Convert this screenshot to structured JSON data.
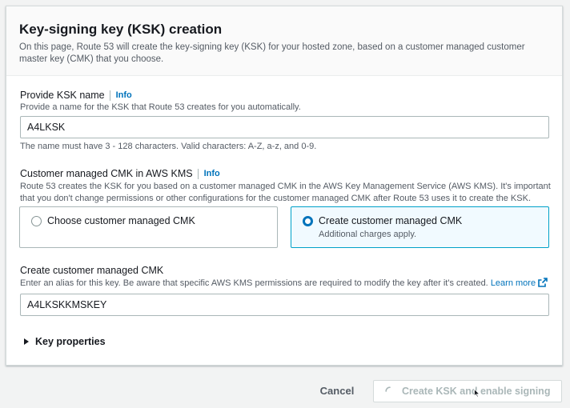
{
  "panel": {
    "title": "Key-signing key (KSK) creation",
    "description": "On this page, Route 53 will create the key-signing key (KSK) for your hosted zone, based on a customer managed customer master key (CMK) that you choose."
  },
  "ksk_name": {
    "label": "Provide KSK name",
    "info": "Info",
    "description": "Provide a name for the KSK that Route 53 creates for you automatically.",
    "value": "A4LKSK",
    "constraint": "The name must have 3 - 128 characters. Valid characters: A-Z, a-z, and 0-9."
  },
  "cmk": {
    "label": "Customer managed CMK in AWS KMS",
    "info": "Info",
    "description": "Route 53 creates the KSK for you based on a customer managed CMK in the AWS Key Management Service (AWS KMS). It's important that you don't change permissions or other configurations for the customer managed CMK after Route 53 uses it to create the KSK.",
    "options": [
      {
        "label": "Choose customer managed CMK",
        "sub": "",
        "selected": false
      },
      {
        "label": "Create customer managed CMK",
        "sub": "Additional charges apply.",
        "selected": true
      }
    ]
  },
  "create_cmk": {
    "label": "Create customer managed CMK",
    "description": "Enter an alias for this key. Be aware that specific AWS KMS permissions are required to modify the key after it's created.",
    "learn_more": "Learn more",
    "value": "A4LKSKKMSKEY"
  },
  "key_properties": {
    "label": "Key properties"
  },
  "footer": {
    "cancel": "Cancel",
    "submit": "Create KSK and enable signing"
  },
  "colors": {
    "link": "#0073bb",
    "selected_tile_bg": "#f1faff",
    "selected_tile_border": "#00a1c9",
    "disabled_text": "#aab7b8"
  },
  "icons": [
    "external-link-icon",
    "caret-right-icon",
    "spinner-icon",
    "pointer-cursor-icon"
  ]
}
